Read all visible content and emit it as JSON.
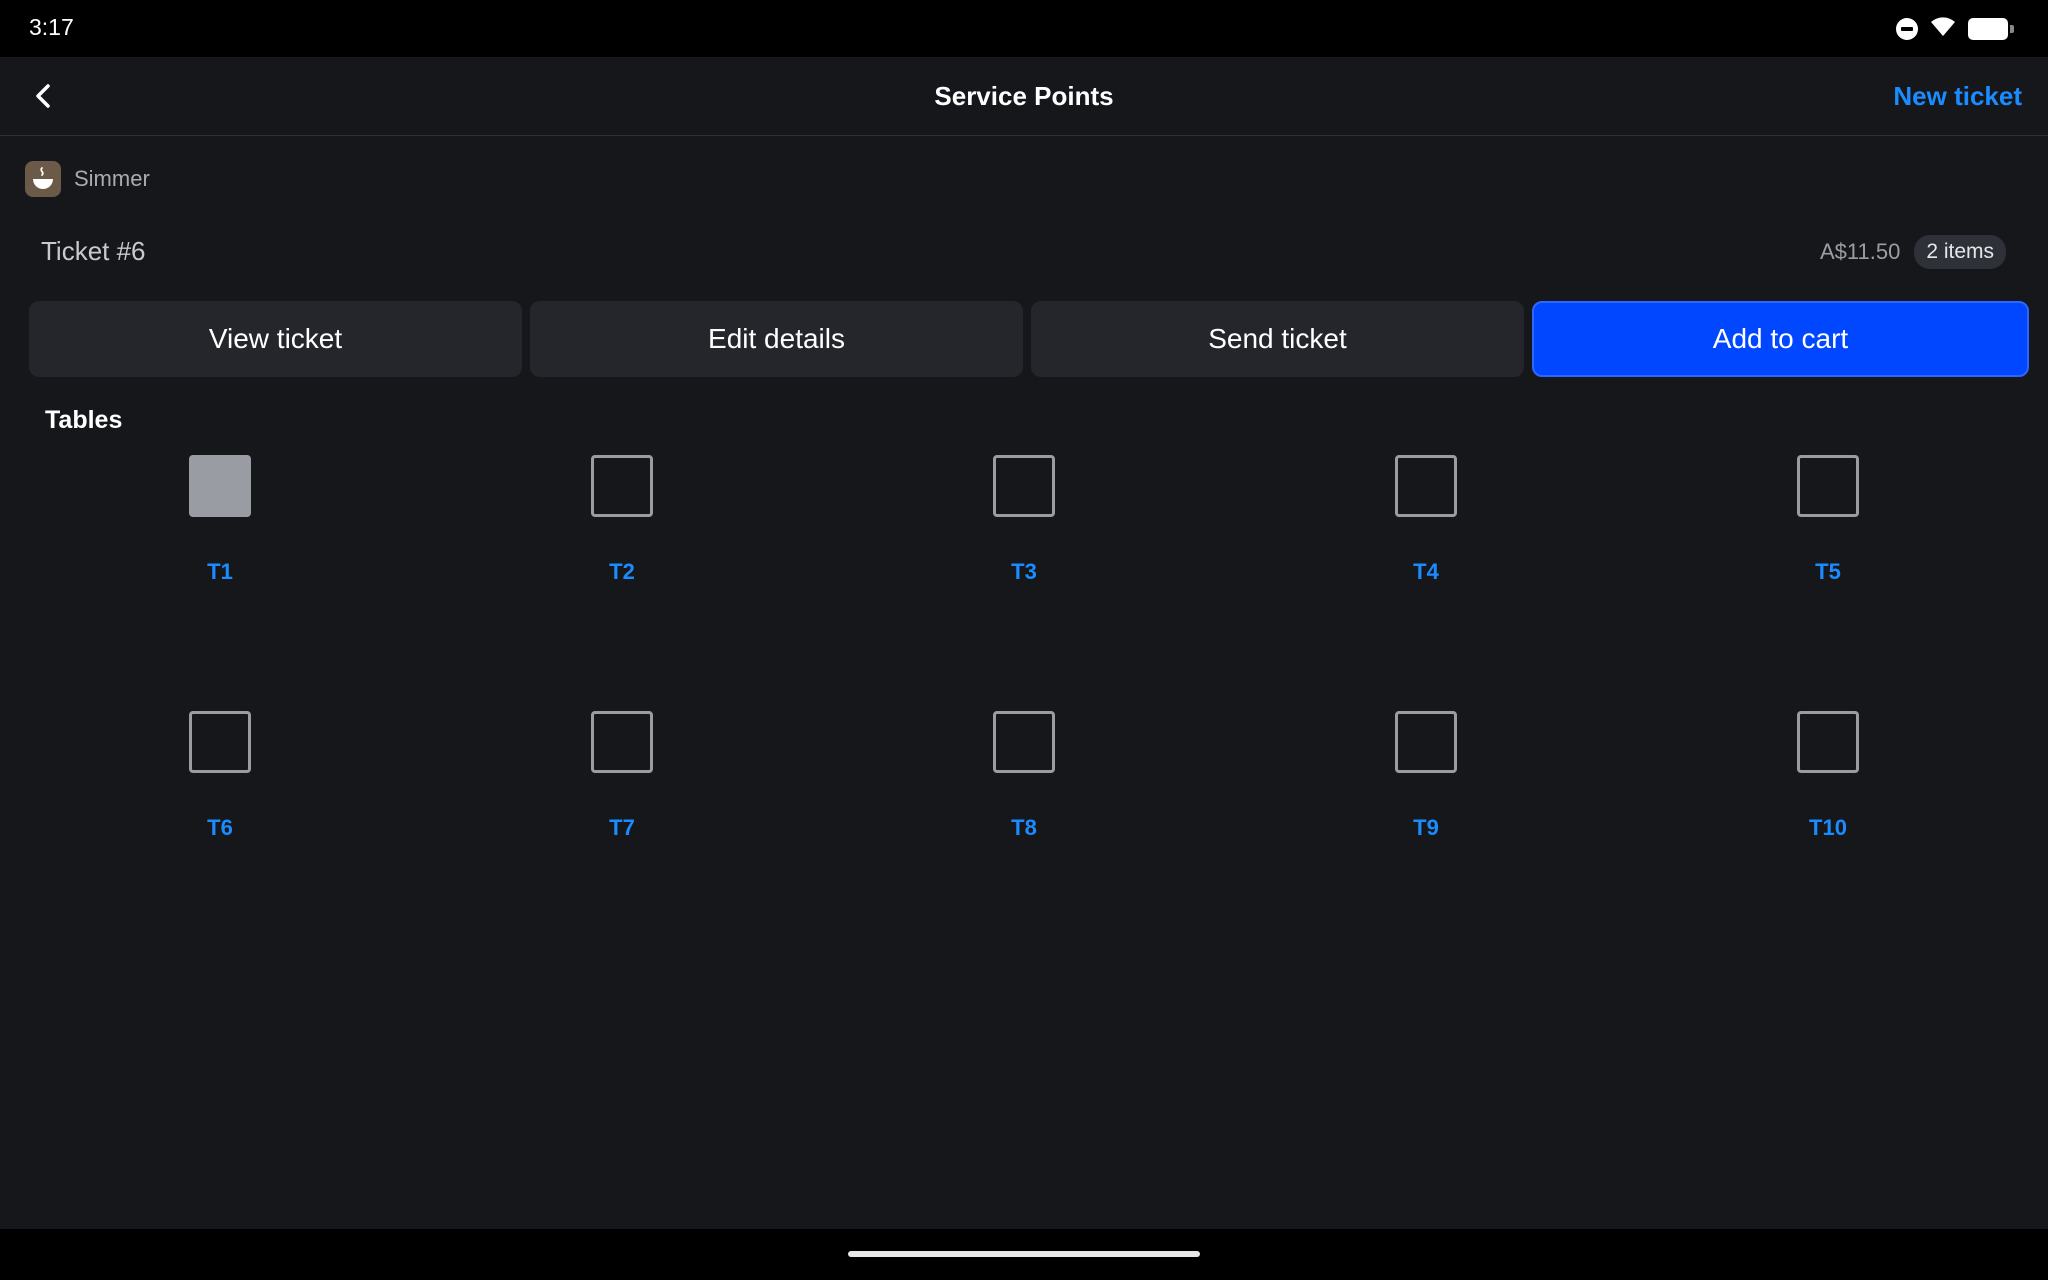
{
  "status_bar": {
    "time": "3:17",
    "icons": [
      "do-not-disturb-icon",
      "wifi-icon",
      "battery-icon"
    ]
  },
  "header": {
    "title": "Service Points",
    "new_ticket_label": "New ticket",
    "back_icon": "chevron-left-icon"
  },
  "venue": {
    "name": "Simmer",
    "avatar_icon": "coffee-cup-icon"
  },
  "ticket": {
    "label": "Ticket #6",
    "total": "A$11.50",
    "items_count": "2 items"
  },
  "actions": {
    "view_ticket": "View ticket",
    "edit_details": "Edit details",
    "send_ticket": "Send ticket",
    "add_to_cart": "Add to cart"
  },
  "tables": {
    "title": "Tables",
    "items": [
      {
        "label": "T1",
        "occupied": true
      },
      {
        "label": "T2",
        "occupied": false
      },
      {
        "label": "T3",
        "occupied": false
      },
      {
        "label": "T4",
        "occupied": false
      },
      {
        "label": "T5",
        "occupied": false
      },
      {
        "label": "T6",
        "occupied": false
      },
      {
        "label": "T7",
        "occupied": false
      },
      {
        "label": "T8",
        "occupied": false
      },
      {
        "label": "T9",
        "occupied": false
      },
      {
        "label": "T10",
        "occupied": false
      }
    ]
  },
  "colors": {
    "background": "#16171b",
    "accent_link": "#1a8cff",
    "primary_button": "#0047ff",
    "secondary_button": "#24262c",
    "table_outline": "#9a9ca3"
  }
}
